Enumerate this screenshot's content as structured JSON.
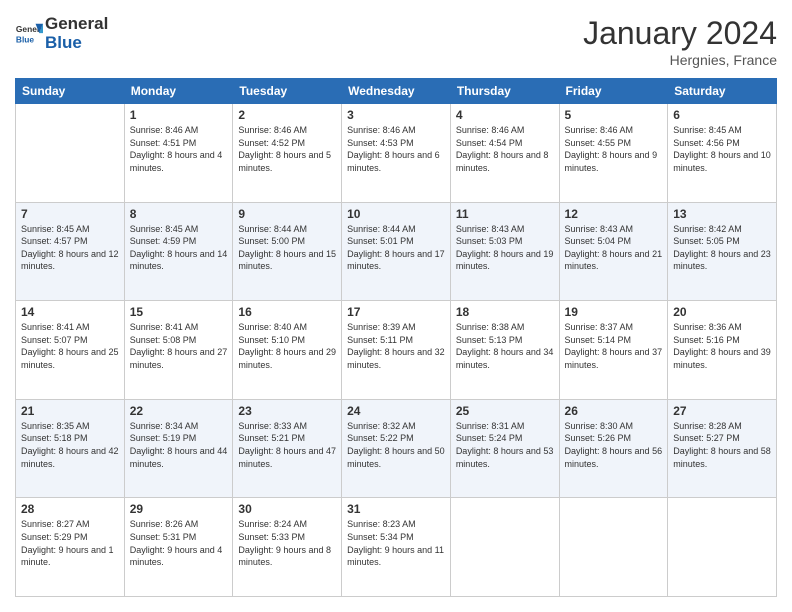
{
  "header": {
    "logo_general": "General",
    "logo_blue": "Blue",
    "month_year": "January 2024",
    "location": "Hergnies, France"
  },
  "days_of_week": [
    "Sunday",
    "Monday",
    "Tuesday",
    "Wednesday",
    "Thursday",
    "Friday",
    "Saturday"
  ],
  "weeks": [
    [
      {
        "day": "",
        "sunrise": "",
        "sunset": "",
        "daylight": ""
      },
      {
        "day": "1",
        "sunrise": "Sunrise: 8:46 AM",
        "sunset": "Sunset: 4:51 PM",
        "daylight": "Daylight: 8 hours and 4 minutes."
      },
      {
        "day": "2",
        "sunrise": "Sunrise: 8:46 AM",
        "sunset": "Sunset: 4:52 PM",
        "daylight": "Daylight: 8 hours and 5 minutes."
      },
      {
        "day": "3",
        "sunrise": "Sunrise: 8:46 AM",
        "sunset": "Sunset: 4:53 PM",
        "daylight": "Daylight: 8 hours and 6 minutes."
      },
      {
        "day": "4",
        "sunrise": "Sunrise: 8:46 AM",
        "sunset": "Sunset: 4:54 PM",
        "daylight": "Daylight: 8 hours and 8 minutes."
      },
      {
        "day": "5",
        "sunrise": "Sunrise: 8:46 AM",
        "sunset": "Sunset: 4:55 PM",
        "daylight": "Daylight: 8 hours and 9 minutes."
      },
      {
        "day": "6",
        "sunrise": "Sunrise: 8:45 AM",
        "sunset": "Sunset: 4:56 PM",
        "daylight": "Daylight: 8 hours and 10 minutes."
      }
    ],
    [
      {
        "day": "7",
        "sunrise": "Sunrise: 8:45 AM",
        "sunset": "Sunset: 4:57 PM",
        "daylight": "Daylight: 8 hours and 12 minutes."
      },
      {
        "day": "8",
        "sunrise": "Sunrise: 8:45 AM",
        "sunset": "Sunset: 4:59 PM",
        "daylight": "Daylight: 8 hours and 14 minutes."
      },
      {
        "day": "9",
        "sunrise": "Sunrise: 8:44 AM",
        "sunset": "Sunset: 5:00 PM",
        "daylight": "Daylight: 8 hours and 15 minutes."
      },
      {
        "day": "10",
        "sunrise": "Sunrise: 8:44 AM",
        "sunset": "Sunset: 5:01 PM",
        "daylight": "Daylight: 8 hours and 17 minutes."
      },
      {
        "day": "11",
        "sunrise": "Sunrise: 8:43 AM",
        "sunset": "Sunset: 5:03 PM",
        "daylight": "Daylight: 8 hours and 19 minutes."
      },
      {
        "day": "12",
        "sunrise": "Sunrise: 8:43 AM",
        "sunset": "Sunset: 5:04 PM",
        "daylight": "Daylight: 8 hours and 21 minutes."
      },
      {
        "day": "13",
        "sunrise": "Sunrise: 8:42 AM",
        "sunset": "Sunset: 5:05 PM",
        "daylight": "Daylight: 8 hours and 23 minutes."
      }
    ],
    [
      {
        "day": "14",
        "sunrise": "Sunrise: 8:41 AM",
        "sunset": "Sunset: 5:07 PM",
        "daylight": "Daylight: 8 hours and 25 minutes."
      },
      {
        "day": "15",
        "sunrise": "Sunrise: 8:41 AM",
        "sunset": "Sunset: 5:08 PM",
        "daylight": "Daylight: 8 hours and 27 minutes."
      },
      {
        "day": "16",
        "sunrise": "Sunrise: 8:40 AM",
        "sunset": "Sunset: 5:10 PM",
        "daylight": "Daylight: 8 hours and 29 minutes."
      },
      {
        "day": "17",
        "sunrise": "Sunrise: 8:39 AM",
        "sunset": "Sunset: 5:11 PM",
        "daylight": "Daylight: 8 hours and 32 minutes."
      },
      {
        "day": "18",
        "sunrise": "Sunrise: 8:38 AM",
        "sunset": "Sunset: 5:13 PM",
        "daylight": "Daylight: 8 hours and 34 minutes."
      },
      {
        "day": "19",
        "sunrise": "Sunrise: 8:37 AM",
        "sunset": "Sunset: 5:14 PM",
        "daylight": "Daylight: 8 hours and 37 minutes."
      },
      {
        "day": "20",
        "sunrise": "Sunrise: 8:36 AM",
        "sunset": "Sunset: 5:16 PM",
        "daylight": "Daylight: 8 hours and 39 minutes."
      }
    ],
    [
      {
        "day": "21",
        "sunrise": "Sunrise: 8:35 AM",
        "sunset": "Sunset: 5:18 PM",
        "daylight": "Daylight: 8 hours and 42 minutes."
      },
      {
        "day": "22",
        "sunrise": "Sunrise: 8:34 AM",
        "sunset": "Sunset: 5:19 PM",
        "daylight": "Daylight: 8 hours and 44 minutes."
      },
      {
        "day": "23",
        "sunrise": "Sunrise: 8:33 AM",
        "sunset": "Sunset: 5:21 PM",
        "daylight": "Daylight: 8 hours and 47 minutes."
      },
      {
        "day": "24",
        "sunrise": "Sunrise: 8:32 AM",
        "sunset": "Sunset: 5:22 PM",
        "daylight": "Daylight: 8 hours and 50 minutes."
      },
      {
        "day": "25",
        "sunrise": "Sunrise: 8:31 AM",
        "sunset": "Sunset: 5:24 PM",
        "daylight": "Daylight: 8 hours and 53 minutes."
      },
      {
        "day": "26",
        "sunrise": "Sunrise: 8:30 AM",
        "sunset": "Sunset: 5:26 PM",
        "daylight": "Daylight: 8 hours and 56 minutes."
      },
      {
        "day": "27",
        "sunrise": "Sunrise: 8:28 AM",
        "sunset": "Sunset: 5:27 PM",
        "daylight": "Daylight: 8 hours and 58 minutes."
      }
    ],
    [
      {
        "day": "28",
        "sunrise": "Sunrise: 8:27 AM",
        "sunset": "Sunset: 5:29 PM",
        "daylight": "Daylight: 9 hours and 1 minute."
      },
      {
        "day": "29",
        "sunrise": "Sunrise: 8:26 AM",
        "sunset": "Sunset: 5:31 PM",
        "daylight": "Daylight: 9 hours and 4 minutes."
      },
      {
        "day": "30",
        "sunrise": "Sunrise: 8:24 AM",
        "sunset": "Sunset: 5:33 PM",
        "daylight": "Daylight: 9 hours and 8 minutes."
      },
      {
        "day": "31",
        "sunrise": "Sunrise: 8:23 AM",
        "sunset": "Sunset: 5:34 PM",
        "daylight": "Daylight: 9 hours and 11 minutes."
      },
      {
        "day": "",
        "sunrise": "",
        "sunset": "",
        "daylight": ""
      },
      {
        "day": "",
        "sunrise": "",
        "sunset": "",
        "daylight": ""
      },
      {
        "day": "",
        "sunrise": "",
        "sunset": "",
        "daylight": ""
      }
    ]
  ]
}
